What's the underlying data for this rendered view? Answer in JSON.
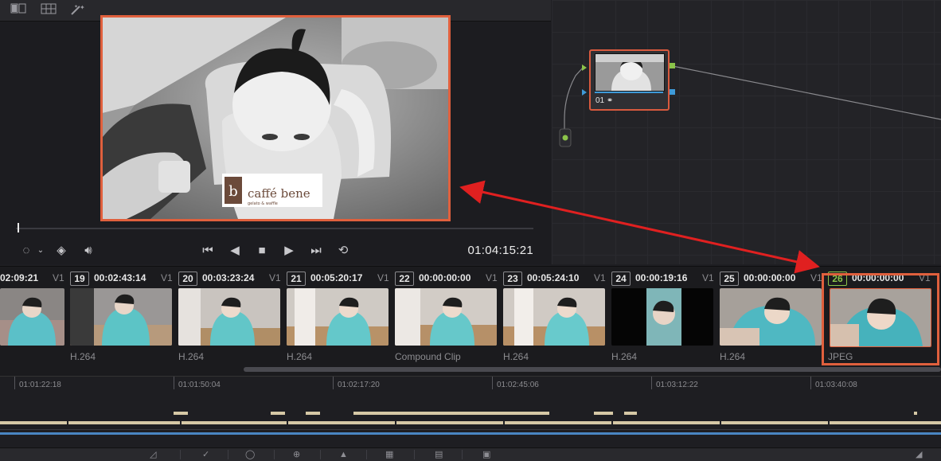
{
  "viewer": {
    "toolbar_icons": [
      "split-view-icon",
      "grid-view-icon",
      "magic-wand-icon"
    ],
    "timecode": "01:04:15:21",
    "logo_text": "caffé bene",
    "logo_sub": "gelato & waffle"
  },
  "node": {
    "label": "01"
  },
  "clips": [
    {
      "num": "",
      "tc": "02:09:21",
      "track": "V1",
      "codec": ""
    },
    {
      "num": "19",
      "tc": "00:02:43:14",
      "track": "V1",
      "codec": "H.264"
    },
    {
      "num": "20",
      "tc": "00:03:23:24",
      "track": "V1",
      "codec": "H.264"
    },
    {
      "num": "21",
      "tc": "00:05:20:17",
      "track": "V1",
      "codec": "H.264"
    },
    {
      "num": "22",
      "tc": "00:00:00:00",
      "track": "V1",
      "codec": "Compound Clip"
    },
    {
      "num": "23",
      "tc": "00:05:24:10",
      "track": "V1",
      "codec": "H.264"
    },
    {
      "num": "24",
      "tc": "00:00:19:16",
      "track": "V1",
      "codec": "H.264"
    },
    {
      "num": "25",
      "tc": "00:00:00:00",
      "track": "V1",
      "codec": "H.264"
    },
    {
      "num": "26",
      "tc": "00:00:00:00",
      "track": "V1",
      "codec": "JPEG"
    }
  ],
  "ruler": [
    "01:01:22:18",
    "01:01:50:04",
    "01:02:17:20",
    "01:02:45:06",
    "01:03:12:22",
    "01:03:40:08"
  ],
  "colors": {
    "highlight": "#e0603d",
    "arrow": "#e02020",
    "node_border": "#d85a3e",
    "port_green": "#8bc34a",
    "port_blue": "#3e9ad8",
    "selected_num": "#8bc34a"
  }
}
